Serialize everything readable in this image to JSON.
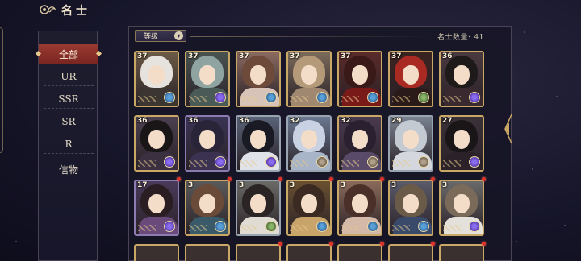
{
  "header": {
    "title": "名士"
  },
  "sidebar": {
    "items": [
      {
        "label": "全部",
        "active": true
      },
      {
        "label": "UR",
        "active": false
      },
      {
        "label": "SSR",
        "active": false
      },
      {
        "label": "SR",
        "active": false
      },
      {
        "label": "R",
        "active": false
      },
      {
        "label": "信物",
        "active": false
      }
    ]
  },
  "toolbar": {
    "sort_label": "等级",
    "count_label": "名士数量:",
    "count_value": "41"
  },
  "cards": [
    {
      "level": "37",
      "frame": "gold",
      "hair": "#e6e2de",
      "robe": "#3b3632",
      "bg": "#6b5a46",
      "rarity": "ssr",
      "new": false
    },
    {
      "level": "37",
      "frame": "gold",
      "hair": "#8fa4a0",
      "robe": "#4a5a56",
      "bg": "#4a5350",
      "rarity": "ur",
      "new": false
    },
    {
      "level": "37",
      "frame": "gold",
      "hair": "#6e4a3a",
      "robe": "#d8c3b8",
      "bg": "#8a6a60",
      "rarity": "ssr",
      "new": false
    },
    {
      "level": "37",
      "frame": "gold",
      "hair": "#b59a7a",
      "robe": "#a08870",
      "bg": "#7a6a5a",
      "rarity": "ssr",
      "new": false
    },
    {
      "level": "37",
      "frame": "gold",
      "hair": "#3a1a18",
      "robe": "#7a1a18",
      "bg": "#5a2a2a",
      "rarity": "ssr",
      "new": false
    },
    {
      "level": "37",
      "frame": "gold",
      "hair": "#a82a22",
      "robe": "#2a1a18",
      "bg": "#3a2320",
      "rarity": "sr",
      "new": false
    },
    {
      "level": "36",
      "frame": "gold",
      "hair": "#1e1a1a",
      "robe": "#3a2a30",
      "bg": "#4a3a40",
      "rarity": "ur",
      "new": false
    },
    {
      "level": "36",
      "frame": "gold",
      "hair": "#1a1618",
      "robe": "#3a3040",
      "bg": "#4a4050",
      "rarity": "ur",
      "new": false
    },
    {
      "level": "36",
      "frame": "purple",
      "hair": "#2a2438",
      "robe": "#3a3250",
      "bg": "#3a3455",
      "rarity": "ur",
      "new": false
    },
    {
      "level": "36",
      "frame": "silver",
      "hair": "#1a1a24",
      "robe": "#e0e4ea",
      "bg": "#5a6478",
      "rarity": "ur",
      "new": false
    },
    {
      "level": "32",
      "frame": "silver",
      "hair": "#c8d2e2",
      "robe": "#a8b4c8",
      "bg": "#6a7890",
      "rarity": "r",
      "new": false
    },
    {
      "level": "32",
      "frame": "gold",
      "hair": "#2a2030",
      "robe": "#5a4a6a",
      "bg": "#4a3a50",
      "rarity": "r",
      "new": false
    },
    {
      "level": "29",
      "frame": "silver",
      "hair": "#c4cad2",
      "robe": "#d4d8de",
      "bg": "#7a8290",
      "rarity": "r",
      "new": false
    },
    {
      "level": "27",
      "frame": "gold",
      "hair": "#1a1618",
      "robe": "#2a2228",
      "bg": "#3a3238",
      "rarity": "ur",
      "new": false
    },
    {
      "level": "17",
      "frame": "purple",
      "hair": "#2a1e22",
      "robe": "#6a4a7a",
      "bg": "#4a3a5a",
      "rarity": "ur",
      "new": true
    },
    {
      "level": "3",
      "frame": "gold",
      "hair": "#6a4a38",
      "robe": "#3a5a6a",
      "bg": "#5a5a5a",
      "rarity": "ssr",
      "new": true
    },
    {
      "level": "3",
      "frame": "silver",
      "hair": "#2a2424",
      "robe": "#e0dcd4",
      "bg": "#6a6a66",
      "rarity": "sr",
      "new": true
    },
    {
      "level": "3",
      "frame": "gold",
      "hair": "#3a2a22",
      "robe": "#c8a46a",
      "bg": "#6a5030",
      "rarity": "ssr",
      "new": true
    },
    {
      "level": "3",
      "frame": "gold",
      "hair": "#4a3028",
      "robe": "#d4b8a8",
      "bg": "#8a6a5a",
      "rarity": "ssr",
      "new": true
    },
    {
      "level": "3",
      "frame": "gold",
      "hair": "#6a5a48",
      "robe": "#3a4a6a",
      "bg": "#5a5a6a",
      "rarity": "ssr",
      "new": true
    },
    {
      "level": "3",
      "frame": "gold",
      "hair": "#7a6a5a",
      "robe": "#e4e0da",
      "bg": "#6a6a6a",
      "rarity": "ur",
      "new": true
    }
  ]
}
